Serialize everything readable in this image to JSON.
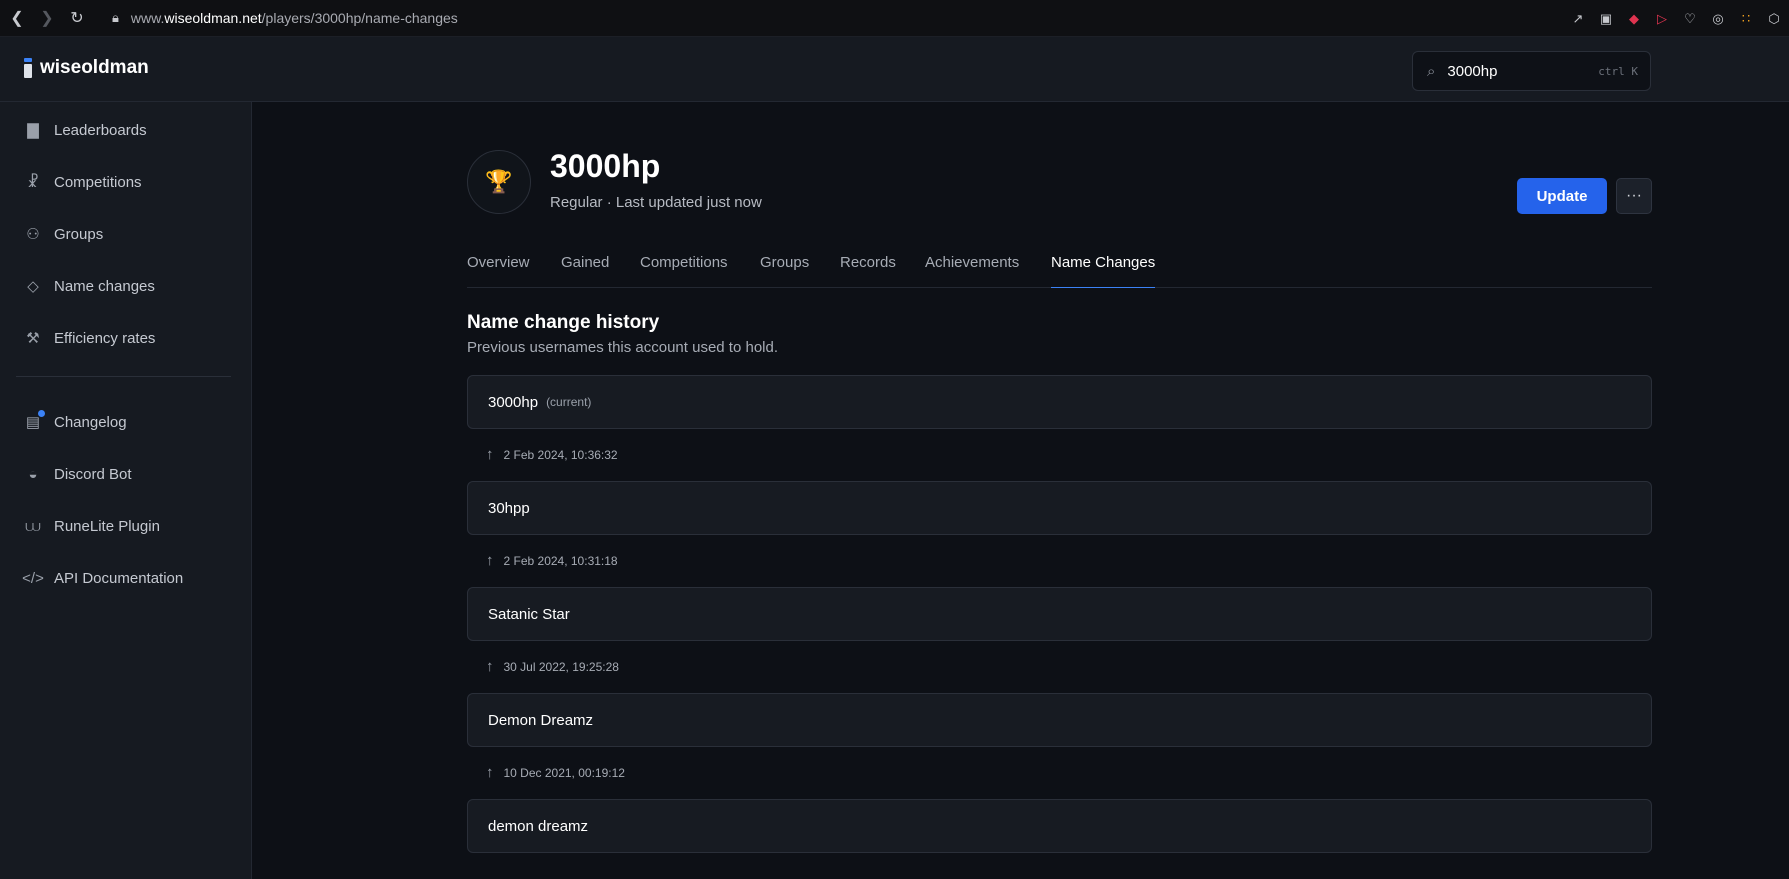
{
  "browser": {
    "url_prefix": "www.",
    "url_domain": "wiseoldman.net",
    "url_path": "/players/3000hp/name-changes"
  },
  "header": {
    "brand": "wiseoldman",
    "search_value": "3000hp",
    "search_shortcut": "ctrl K"
  },
  "sidebar": {
    "primary": [
      {
        "label": "Leaderboards",
        "icon": "bar-chart-icon"
      },
      {
        "label": "Competitions",
        "icon": "trophy-icon"
      },
      {
        "label": "Groups",
        "icon": "users-icon"
      },
      {
        "label": "Name changes",
        "icon": "tag-icon"
      },
      {
        "label": "Efficiency rates",
        "icon": "tools-icon"
      }
    ],
    "secondary": [
      {
        "label": "Changelog",
        "icon": "changelog-icon"
      },
      {
        "label": "Discord Bot",
        "icon": "discord-icon"
      },
      {
        "label": "RuneLite Plugin",
        "icon": "runelite-icon"
      },
      {
        "label": "API Documentation",
        "icon": "code-icon"
      }
    ]
  },
  "player": {
    "name": "3000hp",
    "subtitle": "Regular · Last updated just now",
    "update_label": "Update",
    "more_label": "···"
  },
  "tabs": [
    "Overview",
    "Gained",
    "Competitions",
    "Groups",
    "Records",
    "Achievements",
    "Name Changes"
  ],
  "active_tab": "Name Changes",
  "history": {
    "title": "Name change history",
    "description": "Previous usernames this account used to hold.",
    "current_tag": "(current)",
    "names": [
      "3000hp",
      "30hpp",
      "Satanic Star",
      "Demon Dreamz",
      "demon dreamz"
    ],
    "dates": [
      "2 Feb 2024, 10:36:32",
      "2 Feb 2024, 10:31:18",
      "30 Jul 2022, 19:25:28",
      "10 Dec 2021, 00:19:12"
    ]
  },
  "colors": {
    "accent": "#2563eb",
    "background": "#0d1016",
    "panel": "#161a21"
  }
}
